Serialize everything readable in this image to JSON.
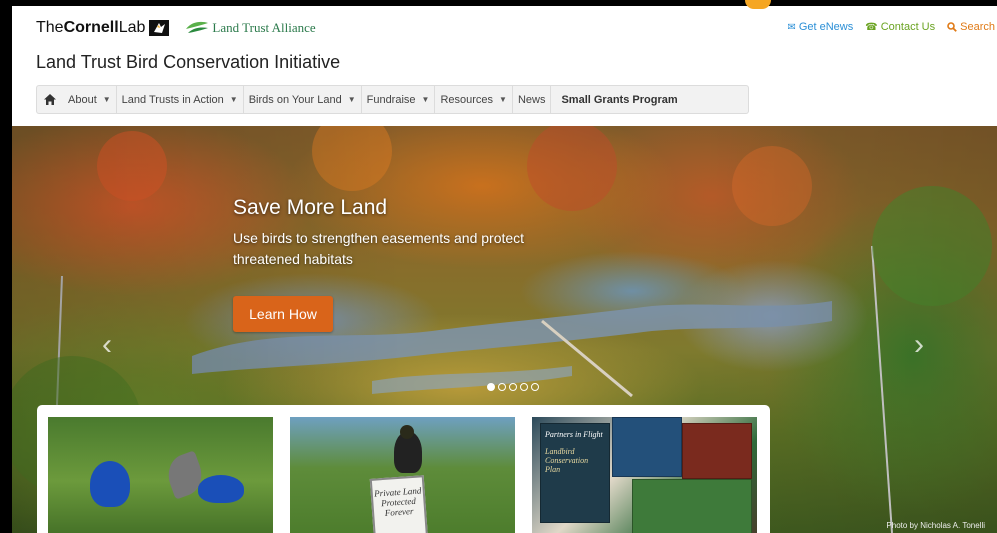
{
  "header": {
    "cornell_logo": {
      "the": "The",
      "cornell": "Cornell",
      "lab": "Lab"
    },
    "lta_logo": "Land Trust Alliance",
    "util_links": [
      {
        "label": "Get eNews",
        "icon": "envelope-icon",
        "color": "#2b8fd6"
      },
      {
        "label": "Contact Us",
        "icon": "phone-icon",
        "color": "#6aa321"
      },
      {
        "label": "Search",
        "icon": "search-icon",
        "color": "#e07a16"
      }
    ],
    "site_title": "Land Trust Bird Conservation Initiative"
  },
  "nav": {
    "home_icon": "home-icon",
    "items": [
      {
        "label": "About",
        "dropdown": true
      },
      {
        "label": "Land Trusts in Action",
        "dropdown": true
      },
      {
        "label": "Birds on Your Land",
        "dropdown": true
      },
      {
        "label": "Fundraise",
        "dropdown": true
      },
      {
        "label": "Resources",
        "dropdown": true
      },
      {
        "label": "News",
        "dropdown": false
      },
      {
        "label": "Small Grants Program",
        "dropdown": false,
        "bold": true
      }
    ]
  },
  "hero": {
    "title": "Save More Land",
    "subtitle": "Use birds to strengthen easements and protect threatened habitats",
    "button_label": "Learn How",
    "button_color": "#d9641a",
    "slides_total": 5,
    "active_slide": 1,
    "photo_credit": "Photo by Nicholas A. Tonelli"
  },
  "cards": {
    "sign_text": "Private Land Protected Forever",
    "book_text": "Partners in Flight",
    "book_subtitle": "Landbird Conservation Plan"
  }
}
